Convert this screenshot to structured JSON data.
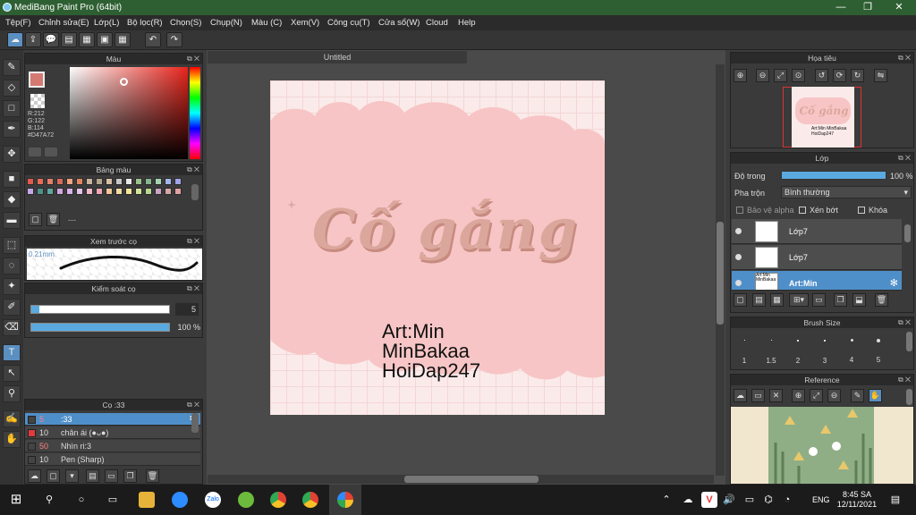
{
  "window": {
    "title": "MediBang Paint Pro (64bit)",
    "min": "—",
    "max": "❐",
    "close": "✕"
  },
  "menu": [
    "Tệp(F)",
    "Chỉnh sửa(E)",
    "Lớp(L)",
    "Bộ lọc(R)",
    "Chọn(S)",
    "Chụp(N)",
    "Màu (C)",
    "Xem(V)",
    "Công cụ(T)",
    "Cửa sổ(W)",
    "Cloud",
    "Help"
  ],
  "color_panel": {
    "title": "Màu",
    "r": "R:212",
    "g": "G:122",
    "b": "B:114",
    "hex": "#D47A72",
    "primary": "#d47a72"
  },
  "palette_panel": {
    "title": "Bảng màu",
    "colors": [
      "#e05a4e",
      "#e86c55",
      "#e37f68",
      "#d86a5a",
      "#f2a37d",
      "#e3865f",
      "#c9b39a",
      "#b4a590",
      "#d7bfa6",
      "#c7c7c7",
      "#e9e9e9",
      "#9cc48a",
      "#86b78b",
      "#a6d4b0",
      "#a2b5e8",
      "#9fa3e8",
      "#c3a8e8",
      "#4e8f8a",
      "#5fa6a0",
      "#cfa6e0",
      "#d8b2ea",
      "#e5c2ea",
      "#f4b9c8",
      "#f3a6b5",
      "#f1c89a",
      "#f4dca4",
      "#f8e79a",
      "#d4e59a",
      "#b8d98e",
      "#c9a4c4",
      "#d6a7a7",
      "#e3a0a0"
    ],
    "count": "---"
  },
  "brush_preview_panel": {
    "title": "Xem trước cọ",
    "size": "0.21mm"
  },
  "brush_control_panel": {
    "title": "Kiểm soát cọ",
    "size_value": "5",
    "opacity_value": "100 %",
    "opacity_fraction": 1.0,
    "size_fraction": 0.06
  },
  "brush_panel": {
    "title": "Cọ :33",
    "items": [
      {
        "size": "5",
        "name": ":33",
        "color": "#444444",
        "selected": true
      },
      {
        "size": "10",
        "name": "chân ái (●ᴗ●)",
        "color": "#e03a3a",
        "selected": false
      },
      {
        "size": "50",
        "name": "Nhìn ri:3",
        "color": "#444444",
        "selected": false
      },
      {
        "size": "10",
        "name": "Pen (Sharp)",
        "color": "#444444",
        "selected": false
      }
    ]
  },
  "document": {
    "tab_title": "Untitled",
    "art_title": "Cố gắng",
    "credit_line1": "Art:Min",
    "credit_line2": "MinBakaa",
    "credit_line3": "HoiDap247"
  },
  "navigator_panel": {
    "title": "Họa tiêu",
    "thumb_title": "Cố gắng",
    "thumb_credit": "Art:Min MinBakaa HoiDap247"
  },
  "layer_panel": {
    "title": "Lớp",
    "opacity_label": "Độ trong",
    "opacity_value": "100 %",
    "blend_label": "Pha trộn",
    "blend_value": "Bình thường",
    "protect_alpha": "Bảo vệ alpha",
    "clipping": "Xén bớt",
    "lock": "Khóa",
    "layers": [
      {
        "name": "Lớp7",
        "thumb_text": ""
      },
      {
        "name": "Lớp7",
        "thumb_text": ""
      },
      {
        "name": "Art:Min",
        "thumb_text": "Art:Min MinBakaa"
      }
    ]
  },
  "brush_size_panel": {
    "title": "Brush Size",
    "sizes": [
      "1",
      "1.5",
      "2",
      "3",
      "4",
      "5"
    ]
  },
  "reference_panel": {
    "title": "Reference"
  },
  "taskbar": {
    "time": "8:45 SA",
    "date": "12/11/2021",
    "lang": "ENG"
  }
}
